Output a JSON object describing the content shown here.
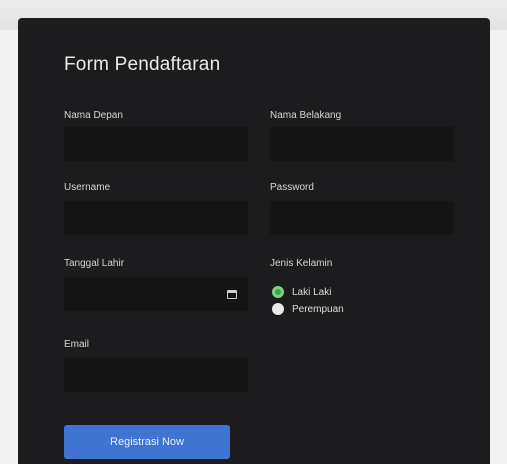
{
  "form": {
    "title": "Form Pendaftaran",
    "fields": {
      "first_name": {
        "label": "Nama Depan",
        "value": ""
      },
      "last_name": {
        "label": "Nama Belakang",
        "value": ""
      },
      "username": {
        "label": "Username",
        "value": ""
      },
      "password": {
        "label": "Password",
        "value": ""
      },
      "birth_date": {
        "label": "Tanggal Lahir",
        "value": ""
      },
      "gender": {
        "label": "Jenis Kelamin",
        "options": [
          {
            "label": "Laki Laki",
            "checked": true
          },
          {
            "label": "Perempuan",
            "checked": false
          }
        ]
      },
      "email": {
        "label": "Email",
        "value": ""
      }
    },
    "submit_label": "Registrasi Now"
  },
  "colors": {
    "page_background": "#f2f2f2",
    "card_background": "#1c1c1e",
    "field_background": "#151516",
    "button": "#3f74d3",
    "radio_selected": "#3ea34a"
  },
  "icons": {
    "date_picker": "calendar-icon"
  }
}
